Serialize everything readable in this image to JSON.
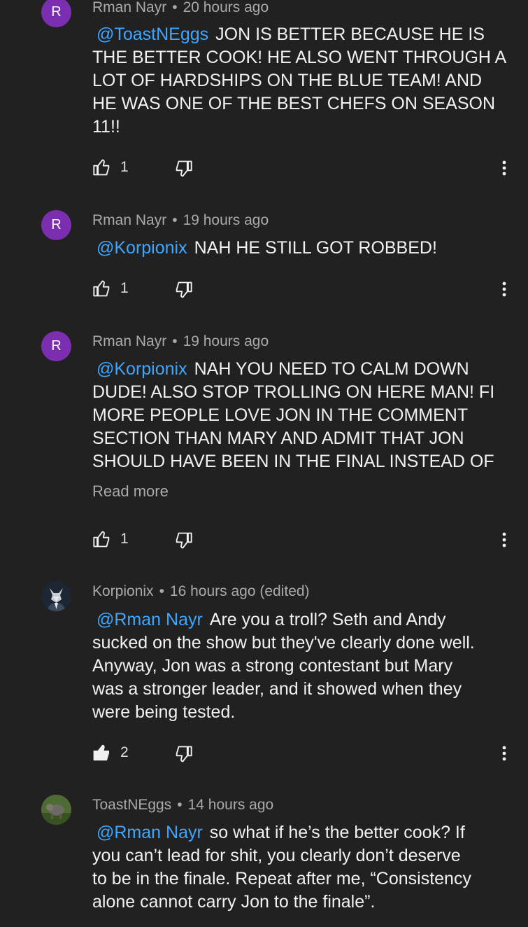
{
  "comments": [
    {
      "avatar_letter": "R",
      "author": "Rman Nayr",
      "time": "20 hours ago",
      "mention": "@ToastNEggs",
      "lines": [
        "JON IS BETTER BECAUSE HE IS",
        "THE BETTER COOK! HE ALSO WENT THROUGH A",
        "LOT OF HARDSHIPS ON THE BLUE TEAM! AND",
        "HE WAS ONE OF THE BEST CHEFS ON SEASON",
        "11!!"
      ],
      "likes": "1",
      "liked": false
    },
    {
      "avatar_letter": "R",
      "author": "Rman Nayr",
      "time": "19 hours ago",
      "mention": "@Korpionix",
      "lines": [
        "NAH HE STILL GOT ROBBED!"
      ],
      "likes": "1",
      "liked": false
    },
    {
      "avatar_letter": "R",
      "author": "Rman Nayr",
      "time": "19 hours ago",
      "mention": "@Korpionix",
      "lines": [
        "NAH YOU NEED TO CALM DOWN",
        "DUDE! ALSO STOP TROLLING ON HERE MAN! FI",
        "MORE PEOPLE LOVE JON IN THE COMMENT",
        "SECTION THAN MARY AND ADMIT THAT JON",
        "SHOULD HAVE BEEN IN THE FINAL INSTEAD OF"
      ],
      "read_more": "Read more",
      "likes": "1",
      "liked": false
    },
    {
      "avatar_icon": "wolf-avatar-icon",
      "author": "Korpionix",
      "time": "16 hours ago (edited)",
      "mention": "@Rman Nayr",
      "lines": [
        "Are you a troll? Seth and Andy",
        "sucked on the show but they've clearly done well.",
        "Anyway, Jon was a strong contestant but Mary",
        "was a stronger leader, and it showed when they",
        "were being tested."
      ],
      "likes": "2",
      "liked": true
    },
    {
      "avatar_icon": "animal-photo-avatar-icon",
      "author": "ToastNEggs",
      "time": "14 hours ago",
      "mention": "@Rman Nayr",
      "lines": [
        "so what if he’s the better cook? If",
        "you can’t lead for shit, you clearly don’t deserve",
        "to be in the finale. Repeat after me, “Consistency",
        "alone cannot carry Jon to the finale”."
      ]
    }
  ],
  "colors": {
    "background": "#212121",
    "mention": "#3ea6ff",
    "meta": "#aaaaaa",
    "avatar": "#7b2fb0"
  }
}
